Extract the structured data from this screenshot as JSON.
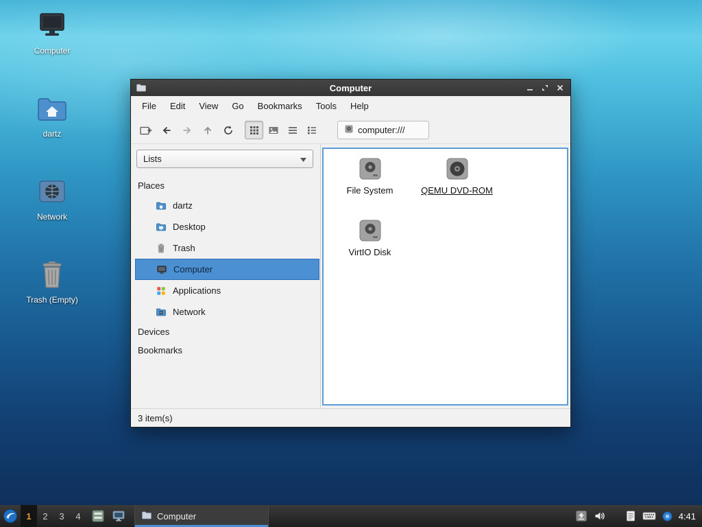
{
  "colors": {
    "selection": "#4a90d2",
    "titlebar": "#3b3b3b",
    "taskbar": "#252525",
    "active_workspace_text": "#e09a3c"
  },
  "desktop": {
    "icons": [
      {
        "name": "computer",
        "label": "Computer"
      },
      {
        "name": "home",
        "label": "dartz"
      },
      {
        "name": "network",
        "label": "Network"
      },
      {
        "name": "trash",
        "label": "Trash (Empty)"
      }
    ]
  },
  "window": {
    "title": "Computer",
    "menu_items": [
      "File",
      "Edit",
      "View",
      "Go",
      "Bookmarks",
      "Tools",
      "Help"
    ],
    "toolbar": {
      "path_value": "computer:///"
    },
    "sidebar": {
      "view_mode": "Lists",
      "places_header": "Places",
      "places": [
        {
          "icon": "home-folder",
          "label": "dartz",
          "selected": false
        },
        {
          "icon": "desktop-folder",
          "label": "Desktop",
          "selected": false
        },
        {
          "icon": "trash",
          "label": "Trash",
          "selected": false
        },
        {
          "icon": "computer",
          "label": "Computer",
          "selected": true
        },
        {
          "icon": "applications",
          "label": "Applications",
          "selected": false
        },
        {
          "icon": "network-folder",
          "label": "Network",
          "selected": false
        }
      ],
      "devices_header": "Devices",
      "bookmarks_header": "Bookmarks"
    },
    "files": [
      {
        "icon": "drive",
        "label": "File System",
        "focused": false
      },
      {
        "icon": "optical",
        "label": "QEMU DVD-ROM",
        "focused": true
      },
      {
        "icon": "drive",
        "label": "VirtIO Disk",
        "focused": false
      }
    ],
    "status": "3 item(s)"
  },
  "taskbar": {
    "workspaces": [
      {
        "label": "1",
        "active": true
      },
      {
        "label": "2",
        "active": false
      },
      {
        "label": "3",
        "active": false
      },
      {
        "label": "4",
        "active": false
      }
    ],
    "task": {
      "label": "Computer",
      "icon": "folder"
    },
    "tray_icons": [
      "removable-media",
      "volume",
      "clipboard",
      "keyboard",
      "input-method"
    ],
    "clock": "4:41"
  }
}
